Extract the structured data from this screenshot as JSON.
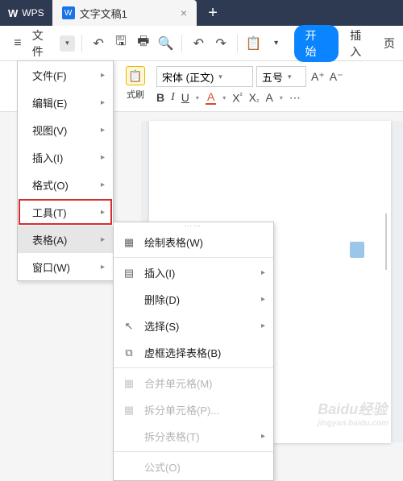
{
  "titlebar": {
    "app_label": "WPS",
    "tab_label": "文字文稿1",
    "close": "×",
    "plus": "+"
  },
  "menubar": {
    "file": "文件",
    "start": "开始",
    "insert": "插入",
    "page_partial": "页"
  },
  "toolbar": {
    "brush": "式刷",
    "font_name": "宋体 (正文)",
    "font_size": "五号",
    "a_plus": "A⁺",
    "a_minus": "A⁻",
    "bold": "B",
    "italic": "I",
    "underline": "U",
    "fontcolor": "A",
    "x2": "X",
    "x2b": "X",
    "a_style": "A",
    "e_style": "⋯"
  },
  "menu1": {
    "items": [
      {
        "label": "文件(F)"
      },
      {
        "label": "编辑(E)"
      },
      {
        "label": "视图(V)"
      },
      {
        "label": "插入(I)"
      },
      {
        "label": "格式(O)"
      },
      {
        "label": "工具(T)"
      },
      {
        "label": "表格(A)"
      },
      {
        "label": "窗口(W)"
      }
    ]
  },
  "menu2": {
    "items": [
      {
        "icon": "▦",
        "label": "绘制表格(W)",
        "arrow": false,
        "disabled": false
      },
      {
        "icon": "▤",
        "label": "插入(I)",
        "arrow": true,
        "disabled": false
      },
      {
        "icon": "",
        "label": "删除(D)",
        "arrow": true,
        "disabled": false
      },
      {
        "icon": "↖",
        "label": "选择(S)",
        "arrow": true,
        "disabled": false
      },
      {
        "icon": "⧉",
        "label": "虚框选择表格(B)",
        "arrow": false,
        "disabled": false
      },
      {
        "icon": "▦",
        "label": "合并单元格(M)",
        "arrow": false,
        "disabled": true
      },
      {
        "icon": "▦",
        "label": "拆分单元格(P)...",
        "arrow": false,
        "disabled": true
      },
      {
        "icon": "",
        "label": "拆分表格(T)",
        "arrow": true,
        "disabled": true
      },
      {
        "icon": "",
        "label": "公式(O)",
        "arrow": false,
        "disabled": true
      }
    ]
  },
  "watermark": {
    "main": "Baidu经验",
    "sub": "jingyan.baidu.com"
  }
}
